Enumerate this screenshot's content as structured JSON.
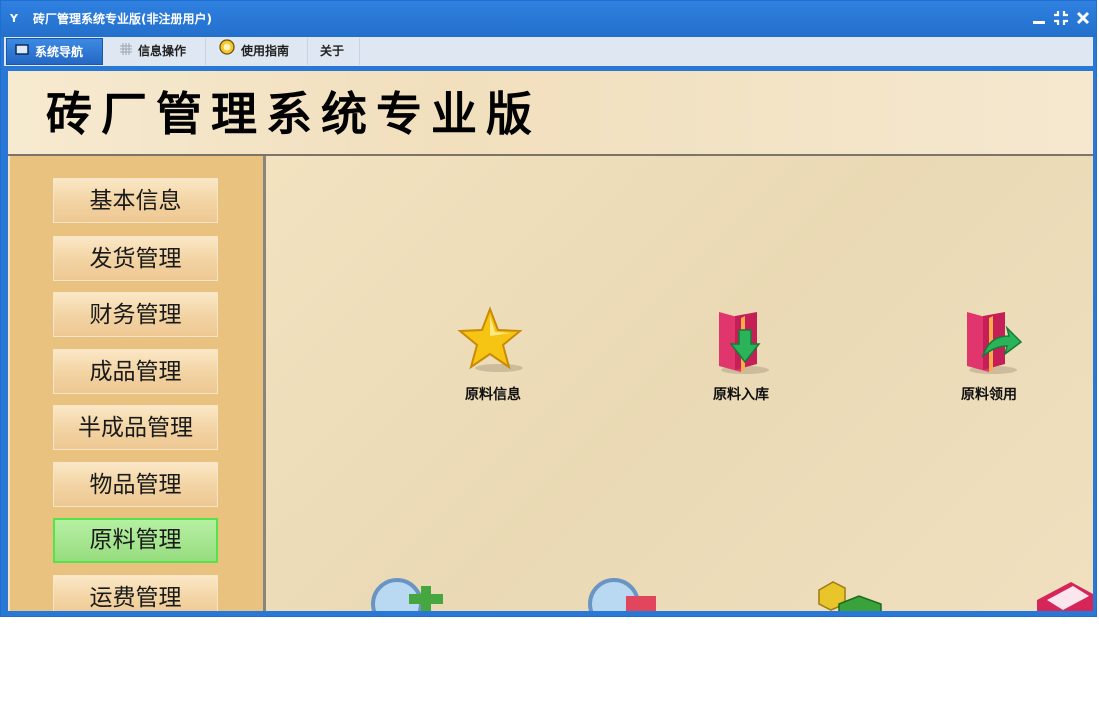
{
  "window": {
    "title": "砖厂管理系统专业版(非注册用户)",
    "app_icon": "Y"
  },
  "menubar": {
    "tabs": [
      {
        "label": "系统导航",
        "icon": "monitor-icon"
      },
      {
        "label": "信息操作",
        "icon": "grid-icon"
      },
      {
        "label": "使用指南",
        "icon": "help-circle-icon"
      },
      {
        "label": "关于",
        "icon": ""
      }
    ]
  },
  "header": {
    "title": "砖厂管理系统专业版"
  },
  "sidebar": {
    "items": [
      {
        "label": "基本信息"
      },
      {
        "label": "发货管理"
      },
      {
        "label": "财务管理"
      },
      {
        "label": "成品管理"
      },
      {
        "label": "半成品管理"
      },
      {
        "label": "物品管理"
      },
      {
        "label": "原料管理"
      },
      {
        "label": "运费管理"
      }
    ],
    "selected": "原料管理"
  },
  "main": {
    "tiles": [
      {
        "label": "原料信息",
        "icon": "star-icon"
      },
      {
        "label": "原料入库",
        "icon": "folder-down-icon"
      },
      {
        "label": "原料领用",
        "icon": "folder-refresh-icon"
      }
    ]
  },
  "colors": {
    "titlebar": "#2a78d6",
    "selected_nav": "#97dc7f",
    "sidebar": "#e9c27f"
  }
}
